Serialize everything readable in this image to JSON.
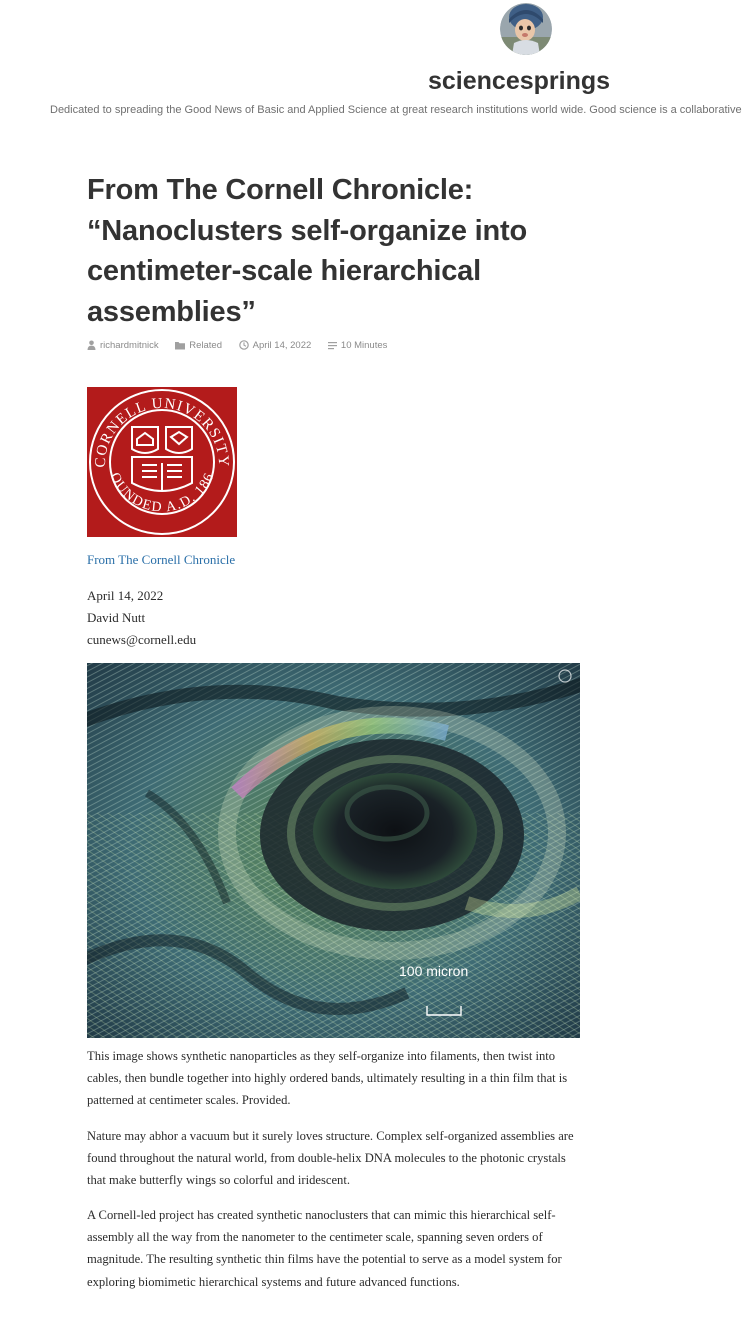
{
  "site": {
    "title": "sciencesprings",
    "description": "Dedicated to spreading the Good News of Basic and Applied Science at great research institutions world wide. Good science is a collaborative human endeavor. Reaching out to research institutions world wide."
  },
  "post": {
    "title": "From The Cornell Chronicle: “Nanoclusters self-organize into centimeter-scale hierarchical assemblies”",
    "meta": {
      "author": "richardmitnick",
      "category": "Related",
      "date": "April 14, 2022",
      "reading_time": "10 Minutes"
    },
    "logo_text": "CORNELL UNIVERSITY FOUNDED A.D. 1865",
    "source_link": "From The Cornell Chronicle",
    "byline": {
      "date": "April 14, 2022",
      "author": "David Nutt",
      "email": "cunews@cornell.edu"
    },
    "image": {
      "scale_label": "100 micron"
    },
    "paragraphs": [
      "This image shows synthetic nanoparticles as they self-organize into filaments, then twist into cables, then bundle together into highly ordered bands, ultimately resulting in a thin film that is patterned at centimeter scales. Provided.",
      "Nature may abhor a vacuum but it surely loves structure. Complex self-organized assemblies are found throughout the natural world, from double-helix DNA molecules to the photonic crystals that make butterfly wings so colorful and iridescent.",
      "A Cornell-led project has created synthetic nanoclusters that can mimic this hierarchical self-assembly all the way from the nanometer to the centimeter scale, spanning seven orders of magnitude. The resulting synthetic thin films have the potential to serve as a model system for exploring biomimetic hierarchical systems and future advanced functions."
    ]
  },
  "icons": {
    "author": "person-icon",
    "category": "folder-icon",
    "date": "clock-icon",
    "reading_time": "lines-icon"
  },
  "colors": {
    "text": "#333333",
    "meta": "#808080",
    "link": "#2a6fa8",
    "cornell_red": "#b31b1b"
  }
}
